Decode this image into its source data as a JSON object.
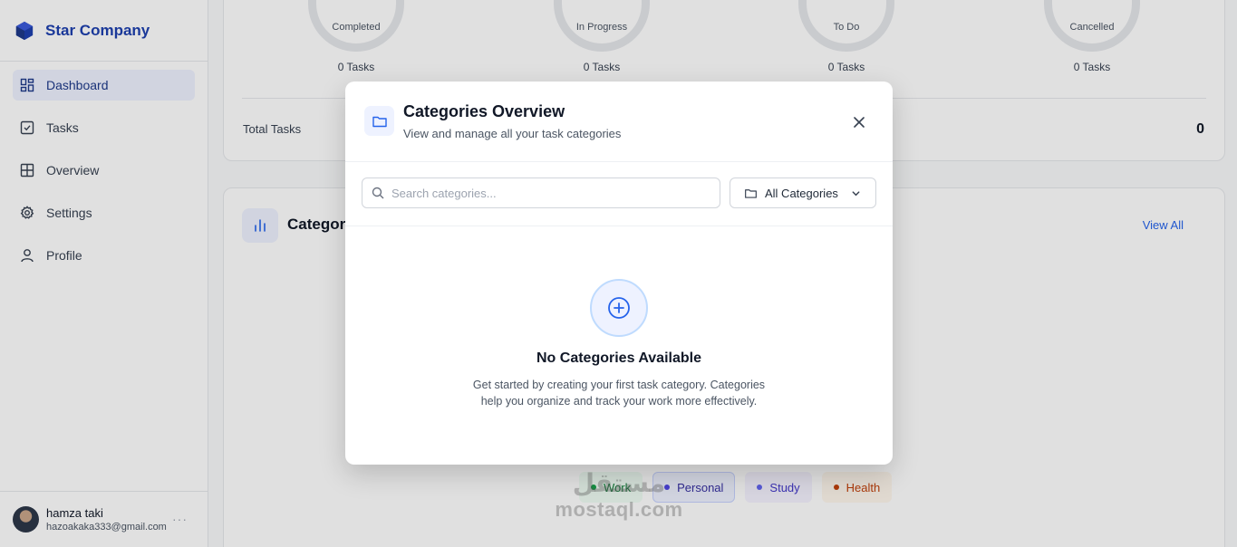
{
  "sidebar": {
    "brand": "Star Company",
    "items": [
      {
        "label": "Dashboard",
        "icon": "dashboard-icon",
        "active": true
      },
      {
        "label": "Tasks",
        "icon": "checkbox-icon"
      },
      {
        "label": "Overview",
        "icon": "grid-icon"
      },
      {
        "label": "Settings",
        "icon": "gear-icon"
      },
      {
        "label": "Profile",
        "icon": "user-icon"
      }
    ],
    "user": {
      "name": "hamza taki",
      "email": "hazoakaka333@gmail.com",
      "more": "···"
    }
  },
  "stats": [
    {
      "label": "Completed",
      "tasks": "0 Tasks"
    },
    {
      "label": "In Progress",
      "tasks": "0 Tasks"
    },
    {
      "label": "To Do",
      "tasks": "0 Tasks"
    },
    {
      "label": "Cancelled",
      "tasks": "0 Tasks"
    }
  ],
  "summary": {
    "total_label": "Total Tasks",
    "total_value": "0"
  },
  "categories_card": {
    "title": "Categor",
    "view_all": "View All",
    "chips": [
      {
        "label": "Work",
        "color": "#16a34a",
        "bg": "#f0fdf4"
      },
      {
        "label": "Personal",
        "color": "#4f46e5",
        "bg": "#eef2ff"
      },
      {
        "label": "Study",
        "color": "#4f46e5",
        "bg": "#f5f3ff"
      },
      {
        "label": "Health",
        "color": "#c2410c",
        "bg": "#fff7ed"
      }
    ]
  },
  "modal": {
    "title": "Categories Overview",
    "subtitle": "View and manage all your task categories",
    "search_placeholder": "Search categories...",
    "filter_label": "All Categories",
    "empty_title": "No Categories Available",
    "empty_desc": "Get started by creating your first task category. Categories help you organize and track your work more effectively."
  },
  "watermark": {
    "arabic": "مستقل",
    "latin": "mostaql.com"
  },
  "colors": {
    "accent": "#2563eb",
    "brand": "#1e40af"
  }
}
